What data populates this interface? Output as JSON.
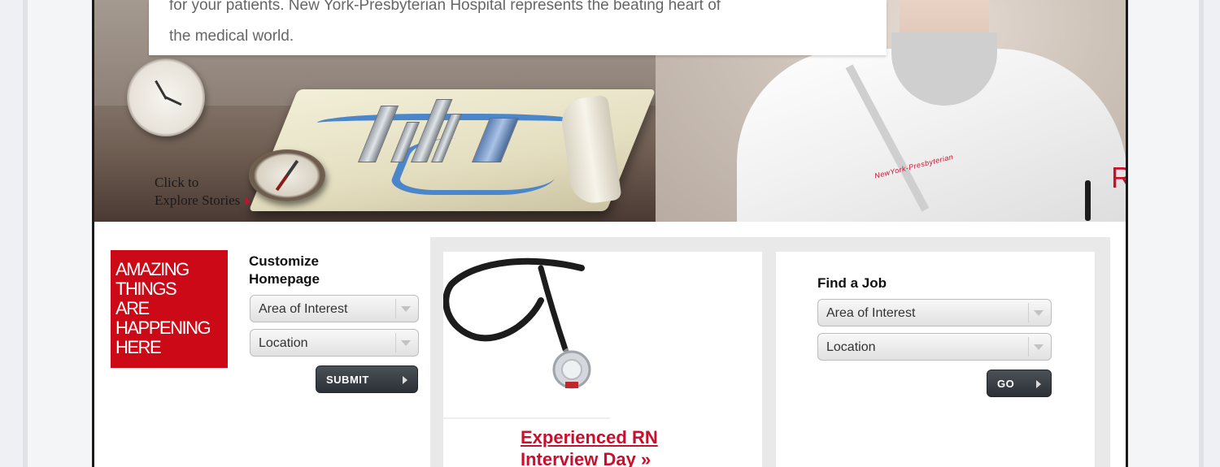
{
  "hero": {
    "intro_line1": "for your patients. New York-Presbyterian Hospital represents the beating heart of",
    "intro_line2": "the medical world.",
    "explore_line1": "Click to",
    "explore_line2": "Explore Stories",
    "badge": "RN",
    "embroidery": "NewYork-Presbyterian"
  },
  "promo": {
    "lines": [
      "AMAZING",
      "THINGS",
      "ARE",
      "HAPPENING",
      "HERE"
    ]
  },
  "customize": {
    "title_line1": "Customize",
    "title_line2": "Homepage",
    "area_select": "Area of Interest",
    "location_select": "Location",
    "submit_label": "SUBMIT"
  },
  "feature": {
    "link_line1": "Experienced RN",
    "link_line2": "Interview Day »"
  },
  "find_job": {
    "title": "Find a Job",
    "area_select": "Area of Interest",
    "location_select": "Location",
    "go_label": "GO"
  },
  "colors": {
    "brand_red": "#cc0a17",
    "link_red": "#c8102e",
    "button_dark": "#2b3136"
  }
}
